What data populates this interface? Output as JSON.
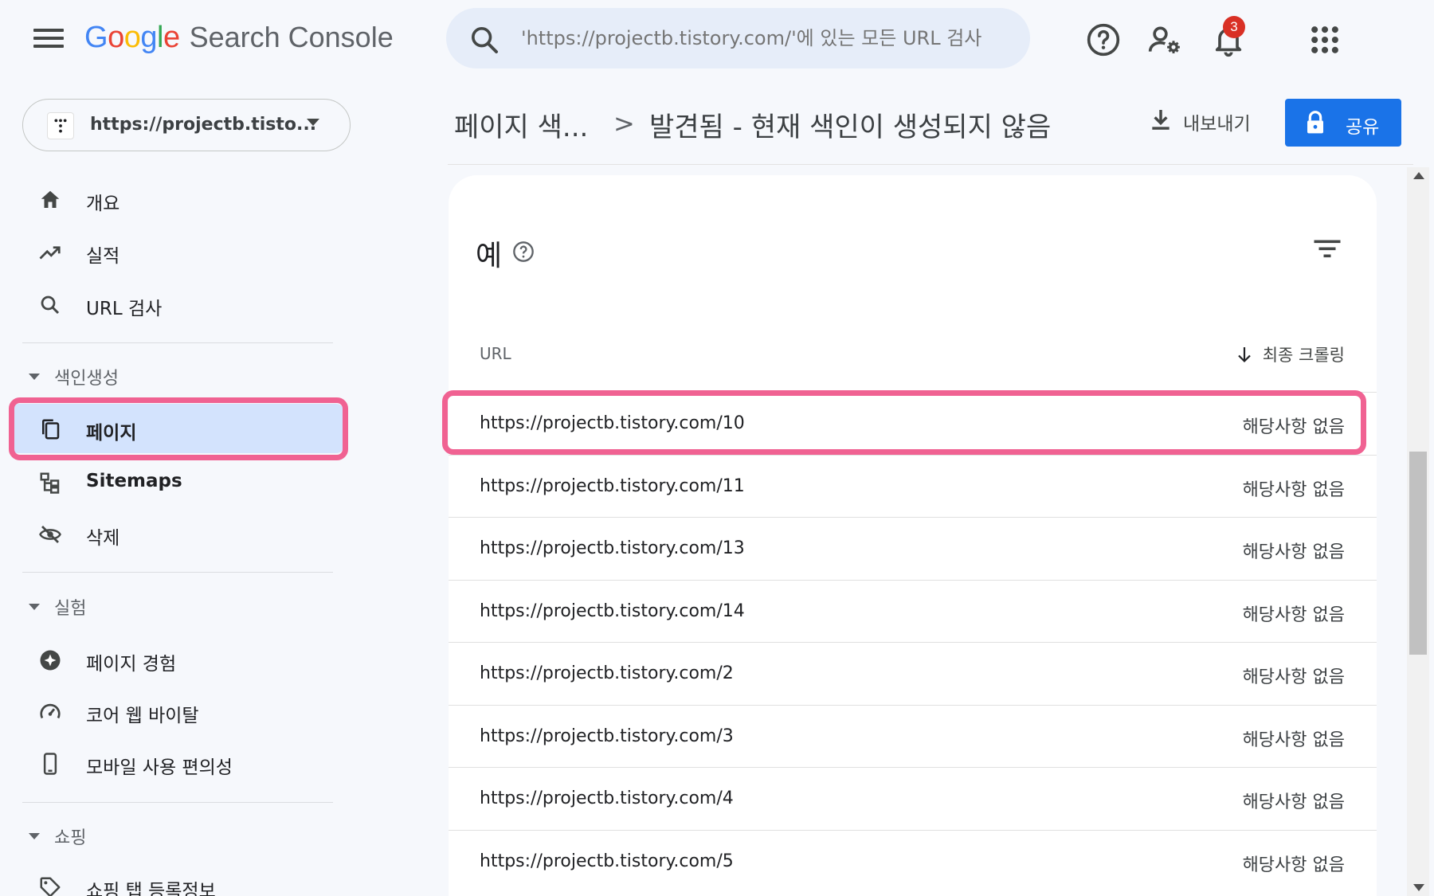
{
  "app": {
    "logo_letters": [
      "G",
      "o",
      "o",
      "g",
      "l",
      "e"
    ],
    "logo_colors": [
      "#4285F4",
      "#EA4335",
      "#FBBC05",
      "#4285F4",
      "#34A853",
      "#EA4335"
    ],
    "product_name": "Search Console"
  },
  "search": {
    "placeholder": "'https://projectb.tistory.com/'에 있는 모든 URL 검사"
  },
  "topbar": {
    "notification_count": "3"
  },
  "property": {
    "label": "https://projectb.tisto..."
  },
  "sidebar": {
    "main_items": [
      {
        "label": "개요",
        "icon": "home-icon"
      },
      {
        "label": "실적",
        "icon": "trending-up-icon"
      },
      {
        "label": "URL 검사",
        "icon": "search-icon"
      }
    ],
    "sections": [
      {
        "title": "색인생성",
        "items": [
          {
            "label": "페이지",
            "icon": "pages-icon",
            "active": true
          },
          {
            "label": "Sitemaps",
            "icon": "sitemap-icon"
          },
          {
            "label": "삭제",
            "icon": "visibility-off-icon"
          }
        ]
      },
      {
        "title": "실험",
        "items": [
          {
            "label": "페이지 경험",
            "icon": "star-badge-icon"
          },
          {
            "label": "코어 웹 바이탈",
            "icon": "speed-icon"
          },
          {
            "label": "모바일 사용 편의성",
            "icon": "smartphone-icon"
          }
        ]
      },
      {
        "title": "쇼핑",
        "items": [
          {
            "label": "쇼핑 탭 등록정보",
            "icon": "tag-icon"
          }
        ]
      }
    ]
  },
  "header": {
    "breadcrumb_parent": "페이지 색...",
    "breadcrumb_separator": ">",
    "breadcrumb_current": "발견됨 - 현재 색인이 생성되지 않음",
    "export_label": "내보내기",
    "share_label": "공유"
  },
  "card": {
    "title": "예",
    "columns": {
      "url": "URL",
      "last_crawl": "최종 크롤링"
    },
    "rows": [
      {
        "url": "https://projectb.tistory.com/10",
        "last_crawl": "해당사항 없음"
      },
      {
        "url": "https://projectb.tistory.com/11",
        "last_crawl": "해당사항 없음"
      },
      {
        "url": "https://projectb.tistory.com/13",
        "last_crawl": "해당사항 없음"
      },
      {
        "url": "https://projectb.tistory.com/14",
        "last_crawl": "해당사항 없음"
      },
      {
        "url": "https://projectb.tistory.com/2",
        "last_crawl": "해당사항 없음"
      },
      {
        "url": "https://projectb.tistory.com/3",
        "last_crawl": "해당사항 없음"
      },
      {
        "url": "https://projectb.tistory.com/4",
        "last_crawl": "해당사항 없음"
      },
      {
        "url": "https://projectb.tistory.com/5",
        "last_crawl": "해당사항 없음"
      }
    ]
  },
  "colors": {
    "accent_blue": "#1a73e8",
    "active_nav_bg": "#d3e3fd",
    "highlight_pink": "#f06292",
    "badge_red": "#d93025"
  }
}
